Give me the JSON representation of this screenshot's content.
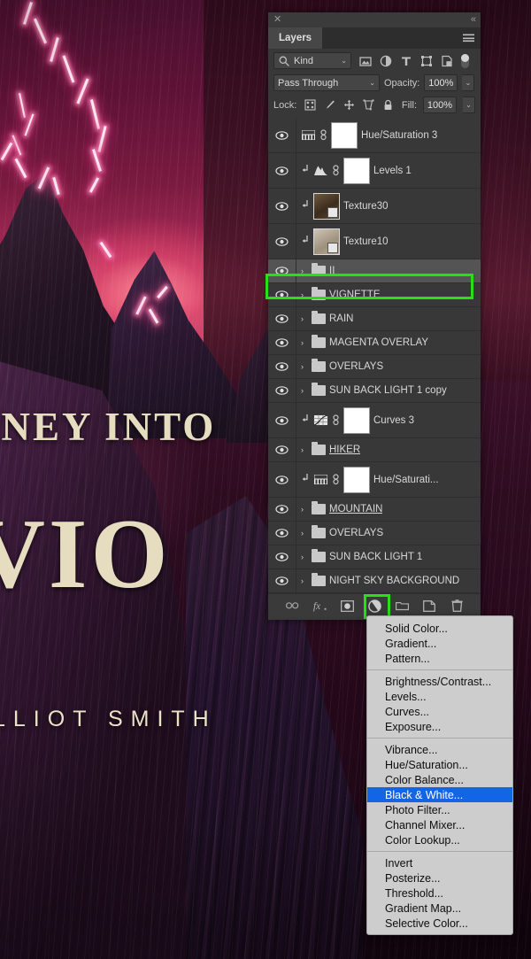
{
  "artwork": {
    "cover_line1": "RNEY INTO",
    "cover_line2": "VIO",
    "cover_author": "LLIOT SMITH"
  },
  "panel": {
    "close_icon": "✕",
    "collapse_icon": "«",
    "tab_label": "Layers",
    "menu_icon": "hamburger-icon"
  },
  "filter": {
    "kind_label": "Kind",
    "search_icon": "⚲",
    "caret": "⌄",
    "icons": [
      "pixel-filter-icon",
      "adjustment-filter-icon",
      "type-filter-icon",
      "shape-filter-icon",
      "smart-object-filter-icon"
    ],
    "toggle": "filter-enable-toggle"
  },
  "blend": {
    "mode": "Pass Through",
    "opacity_label": "Opacity:",
    "opacity_value": "100%",
    "caret": "⌄"
  },
  "lock": {
    "label": "Lock:",
    "icons": [
      "lock-transparency-icon",
      "lock-image-icon",
      "lock-position-icon",
      "lock-artboard-icon",
      "lock-all-icon"
    ],
    "fill_label": "Fill:",
    "fill_value": "100%"
  },
  "layers": [
    {
      "name": "Hue/Saturation 3",
      "type": "adjustment",
      "adj": "hue-saturation",
      "visible": true,
      "clipped": false,
      "mask": true,
      "link": true,
      "selected": false,
      "underline": false
    },
    {
      "name": "Levels 1",
      "type": "adjustment",
      "adj": "levels",
      "visible": true,
      "clipped": true,
      "mask": true,
      "link": true,
      "selected": false,
      "underline": false
    },
    {
      "name": "Texture30",
      "type": "texture",
      "thumb": "t30",
      "visible": true,
      "clipped": true,
      "mask": false,
      "link": false,
      "selected": false,
      "underline": false
    },
    {
      "name": "Texture10",
      "type": "texture",
      "thumb": "t10",
      "visible": true,
      "clipped": true,
      "mask": false,
      "link": false,
      "selected": false,
      "underline": false
    },
    {
      "name": "II",
      "type": "group",
      "visible": true,
      "clipped": false,
      "mask": false,
      "link": false,
      "selected": true,
      "underline": true
    },
    {
      "name": "VIGNETTE",
      "type": "group",
      "visible": true,
      "clipped": false,
      "mask": false,
      "link": false,
      "selected": false,
      "underline": false
    },
    {
      "name": "RAIN",
      "type": "group",
      "visible": true,
      "clipped": false,
      "mask": false,
      "link": false,
      "selected": false,
      "underline": false
    },
    {
      "name": "MAGENTA OVERLAY",
      "type": "group",
      "visible": true,
      "clipped": false,
      "mask": false,
      "link": false,
      "selected": false,
      "underline": false
    },
    {
      "name": "OVERLAYS",
      "type": "group",
      "visible": true,
      "clipped": false,
      "mask": false,
      "link": false,
      "selected": false,
      "underline": false
    },
    {
      "name": "SUN BACK LIGHT 1 copy",
      "type": "group",
      "visible": true,
      "clipped": false,
      "mask": false,
      "link": false,
      "selected": false,
      "underline": false
    },
    {
      "name": "Curves 3",
      "type": "adjustment",
      "adj": "curves",
      "visible": true,
      "clipped": true,
      "mask": true,
      "link": true,
      "selected": false,
      "underline": false
    },
    {
      "name": "HIKER",
      "type": "group",
      "visible": true,
      "clipped": false,
      "mask": false,
      "link": false,
      "selected": false,
      "underline": true
    },
    {
      "name": "Hue/Saturati...",
      "type": "adjustment",
      "adj": "hue-saturation",
      "visible": true,
      "clipped": true,
      "mask": true,
      "link": true,
      "selected": false,
      "underline": false
    },
    {
      "name": "MOUNTAIN",
      "type": "group",
      "visible": true,
      "clipped": false,
      "mask": false,
      "link": false,
      "selected": false,
      "underline": true
    },
    {
      "name": "OVERLAYS",
      "type": "group",
      "visible": true,
      "clipped": false,
      "mask": false,
      "link": false,
      "selected": false,
      "underline": false
    },
    {
      "name": "SUN BACK LIGHT 1",
      "type": "group",
      "visible": true,
      "clipped": false,
      "mask": false,
      "link": false,
      "selected": false,
      "underline": false
    },
    {
      "name": "NIGHT SKY BACKGROUND",
      "type": "group",
      "visible": true,
      "clipped": false,
      "mask": false,
      "link": false,
      "selected": false,
      "underline": false
    }
  ],
  "footer_buttons": [
    {
      "name": "link-layers-button",
      "icon": "GO"
    },
    {
      "name": "layer-style-button",
      "icon": "fx"
    },
    {
      "name": "add-mask-button",
      "icon": "mask"
    },
    {
      "name": "new-adjustment-layer-button",
      "icon": "adjustment",
      "highlighted": true
    },
    {
      "name": "new-group-button",
      "icon": "folder"
    },
    {
      "name": "new-layer-button",
      "icon": "new-layer"
    },
    {
      "name": "delete-layer-button",
      "icon": "trash"
    }
  ],
  "adjust_menu": {
    "groups": [
      {
        "items": [
          {
            "label": "Solid Color...",
            "highlight": false
          },
          {
            "label": "Gradient...",
            "highlight": false
          },
          {
            "label": "Pattern...",
            "highlight": false
          }
        ]
      },
      {
        "items": [
          {
            "label": "Brightness/Contrast...",
            "highlight": false
          },
          {
            "label": "Levels...",
            "highlight": false
          },
          {
            "label": "Curves...",
            "highlight": false
          },
          {
            "label": "Exposure...",
            "highlight": false
          }
        ]
      },
      {
        "items": [
          {
            "label": "Vibrance...",
            "highlight": false
          },
          {
            "label": "Hue/Saturation...",
            "highlight": false
          },
          {
            "label": "Color Balance...",
            "highlight": false
          },
          {
            "label": "Black & White...",
            "highlight": true
          },
          {
            "label": "Photo Filter...",
            "highlight": false
          },
          {
            "label": "Channel Mixer...",
            "highlight": false
          },
          {
            "label": "Color Lookup...",
            "highlight": false
          }
        ]
      },
      {
        "items": [
          {
            "label": "Invert",
            "highlight": false
          },
          {
            "label": "Posterize...",
            "highlight": false
          },
          {
            "label": "Threshold...",
            "highlight": false
          },
          {
            "label": "Gradient Map...",
            "highlight": false
          },
          {
            "label": "Selective Color...",
            "highlight": false
          }
        ]
      }
    ]
  },
  "colors": {
    "highlight_green": "#27e016",
    "menu_selection_blue": "#1464e6",
    "panel_bg": "#383838",
    "selected_row": "#545454"
  }
}
